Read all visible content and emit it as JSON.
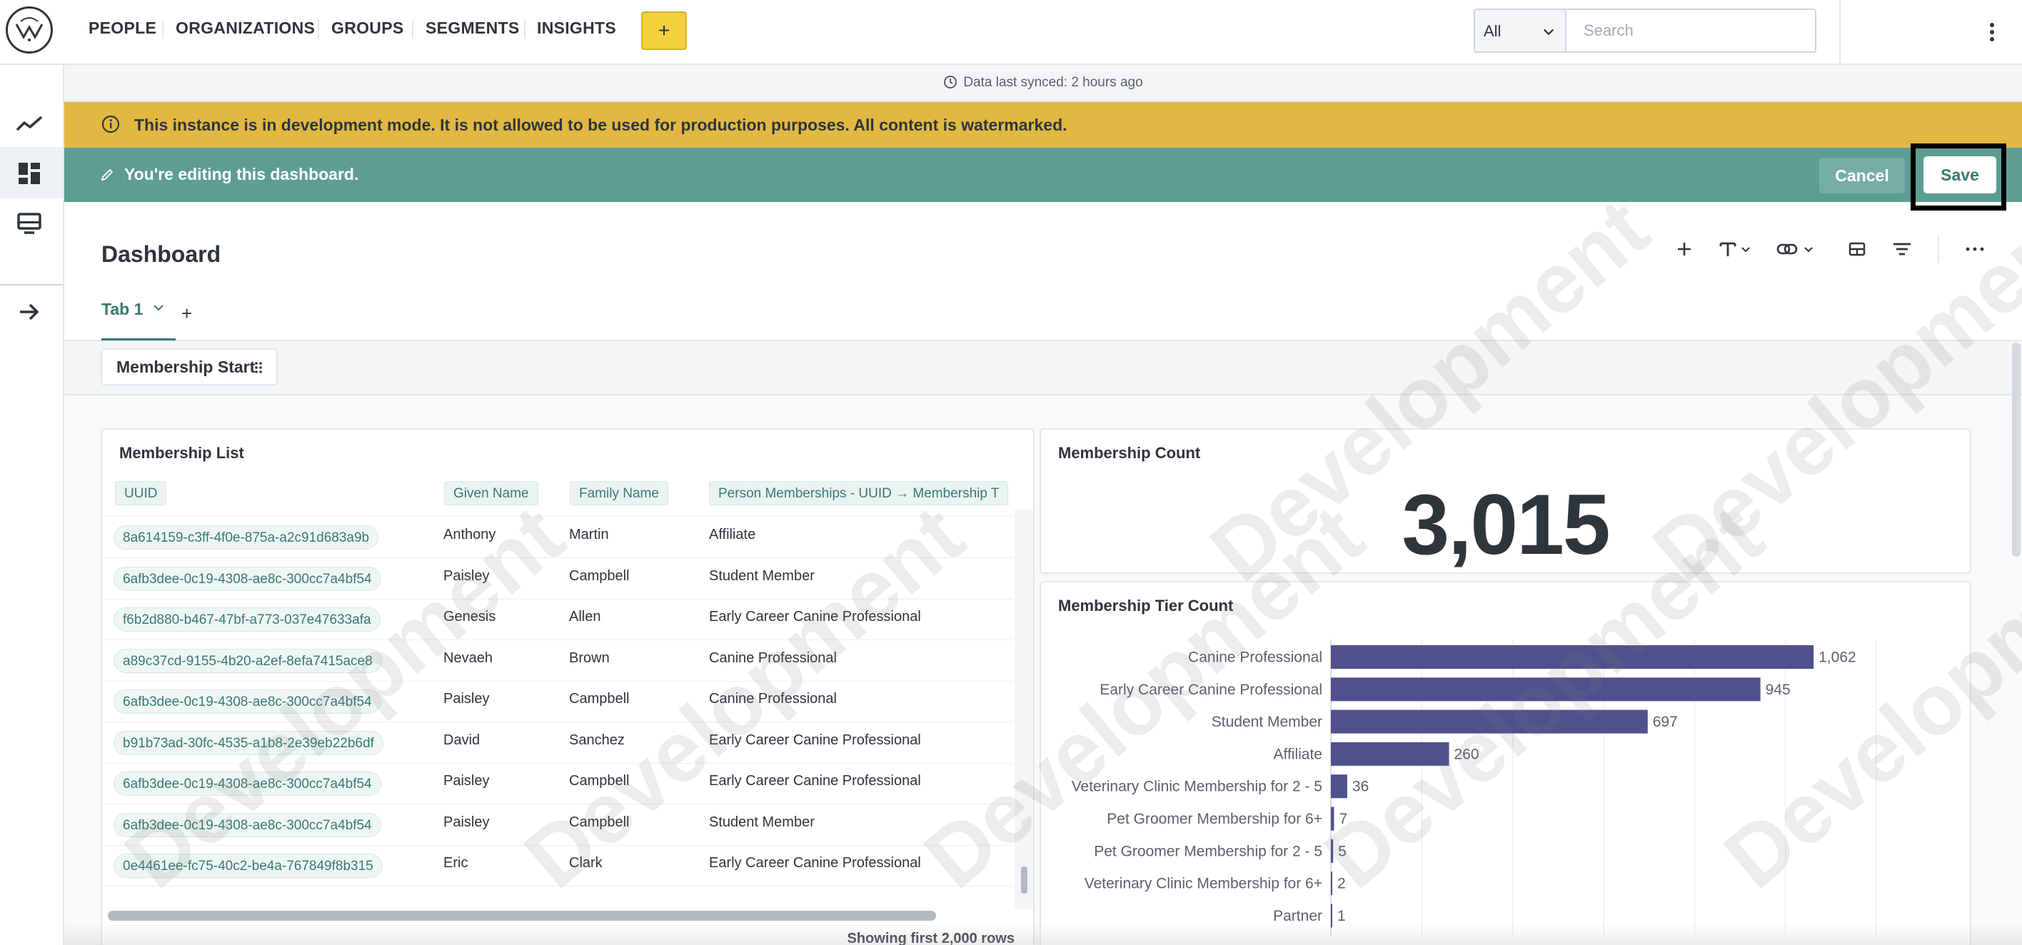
{
  "nav": {
    "items": [
      "PEOPLE",
      "ORGANIZATIONS",
      "GROUPS",
      "SEGMENTS",
      "INSIGHTS"
    ],
    "active": "INSIGHTS",
    "new_label": "+",
    "scope_value": "All",
    "search_placeholder": "Search"
  },
  "sync": {
    "text": "Data last synced: 2 hours ago"
  },
  "dev_banner": {
    "text": "This instance is in development mode. It is not allowed to be used for production purposes. All content is watermarked."
  },
  "edit_bar": {
    "text": "You're editing this dashboard.",
    "cancel_label": "Cancel",
    "save_label": "Save"
  },
  "dashboard": {
    "title": "Dashboard",
    "tab_label": "Tab 1",
    "add_tab_label": "+",
    "filter_label": "Membership Start"
  },
  "membership_list": {
    "title": "Membership List",
    "columns": [
      "UUID",
      "Given Name",
      "Family Name",
      "Person Memberships - UUID → Membership T"
    ],
    "rows": [
      [
        "8a614159-c3ff-4f0e-875a-a2c91d683a9b",
        "Anthony",
        "Martin",
        "Affiliate"
      ],
      [
        "6afb3dee-0c19-4308-ae8c-300cc7a4bf54",
        "Paisley",
        "Campbell",
        "Student Member"
      ],
      [
        "f6b2d880-b467-47bf-a773-037e47633afa",
        "Genesis",
        "Allen",
        "Early Career Canine Professional"
      ],
      [
        "a89c37cd-9155-4b20-a2ef-8efa7415ace8",
        "Nevaeh",
        "Brown",
        "Canine Professional"
      ],
      [
        "6afb3dee-0c19-4308-ae8c-300cc7a4bf54",
        "Paisley",
        "Campbell",
        "Canine Professional"
      ],
      [
        "b91b73ad-30fc-4535-a1b8-2e39eb22b6df",
        "David",
        "Sanchez",
        "Early Career Canine Professional"
      ],
      [
        "6afb3dee-0c19-4308-ae8c-300cc7a4bf54",
        "Paisley",
        "Campbell",
        "Early Career Canine Professional"
      ],
      [
        "6afb3dee-0c19-4308-ae8c-300cc7a4bf54",
        "Paisley",
        "Campbell",
        "Student Member"
      ],
      [
        "0e4461ee-fc75-40c2-be4a-767849f8b315",
        "Eric",
        "Clark",
        "Early Career Canine Professional"
      ]
    ],
    "footer": "Showing first 2,000 rows"
  },
  "membership_count": {
    "title": "Membership Count",
    "value": "3,015"
  },
  "membership_tier": {
    "title": "Membership Tier Count"
  },
  "chart_data": {
    "type": "bar",
    "orientation": "horizontal",
    "categories": [
      "Canine Professional",
      "Early Career Canine Professional",
      "Student Member",
      "Affiliate",
      "Veterinary Clinic Membership for 2 - 5",
      "Pet Groomer Membership for 6+",
      "Pet Groomer Membership for 2 - 5",
      "Veterinary Clinic Membership for 6+",
      "Partner"
    ],
    "values": [
      1062,
      945,
      697,
      260,
      36,
      7,
      5,
      2,
      1
    ],
    "value_labels": [
      "1,062",
      "945",
      "697",
      "260",
      "36",
      "7",
      "5",
      "2",
      "1"
    ],
    "xlim": [
      0,
      1200
    ],
    "grid": true,
    "color": "#50518c"
  },
  "watermark": {
    "text": "Development"
  },
  "colors": {
    "accent": "#387a70",
    "edit_bar": "#5d9d93",
    "dev_banner": "#e2b842",
    "new_button": "#f2d13e"
  }
}
